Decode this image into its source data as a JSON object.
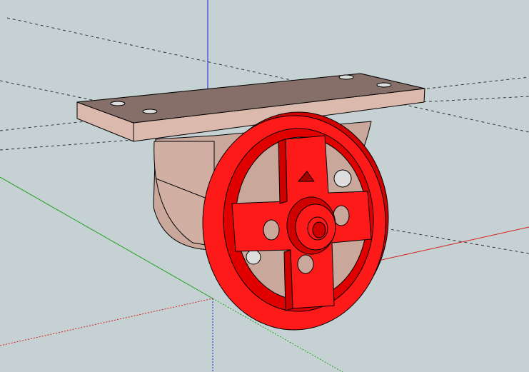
{
  "viewport": {
    "background": "#c6d1d4",
    "axes": {
      "red": "#d42020",
      "green": "#1ea01e",
      "blue": "#2020d0"
    },
    "guide_color": "#333333"
  },
  "model": {
    "bracket_color": "#d9b7ab",
    "bracket_dark": "#b69187",
    "wheel_color": "#ff1a1a",
    "wheel_dark": "#d00000",
    "edge_color": "#000000"
  }
}
